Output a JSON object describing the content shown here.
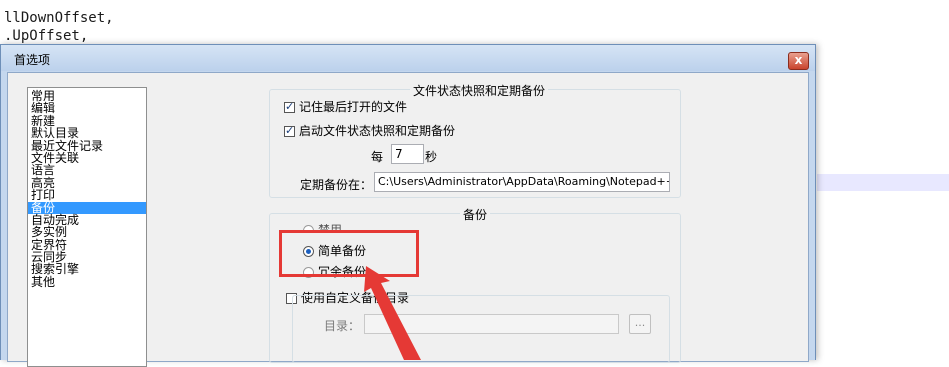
{
  "editor": {
    "lines": [
      "llDownOffset,",
      ".UpOffset,",
      "- "
    ]
  },
  "dialog": {
    "title": "首选项",
    "close_glyph": "x"
  },
  "categories": [
    "常用",
    "编辑",
    "新建",
    "默认目录",
    "最近文件记录",
    "文件关联",
    "语言",
    "高亮",
    "打印",
    "备份",
    "自动完成",
    "多实例",
    "定界符",
    "云同步",
    "搜索引擎",
    "其他"
  ],
  "selected_category": "备份",
  "snapshot": {
    "group_title": "文件状态快照和定期备份",
    "remember_last_files": "记住最后打开的文件",
    "remember_last_files_checked": true,
    "enable_snapshot": "启动文件状态快照和定期备份",
    "enable_snapshot_checked": true,
    "every_label": "每",
    "interval_value": "7",
    "seconds_label": "秒",
    "path_label": "定期备份在：",
    "path_value": "C:\\Users\\Administrator\\AppData\\Roaming\\Notepad++\\backup\\"
  },
  "backup": {
    "group_title": "备份",
    "option_disabled": "禁用",
    "option_simple": "简单备份",
    "option_verbose": "冗余备份",
    "selected": "简单备份",
    "custom_dir_label": "使用自定义备份目录",
    "custom_dir_checked": false,
    "dir_label": "目录：",
    "dir_value": "",
    "browse_label": "..."
  },
  "annotation_color": "#e53935"
}
